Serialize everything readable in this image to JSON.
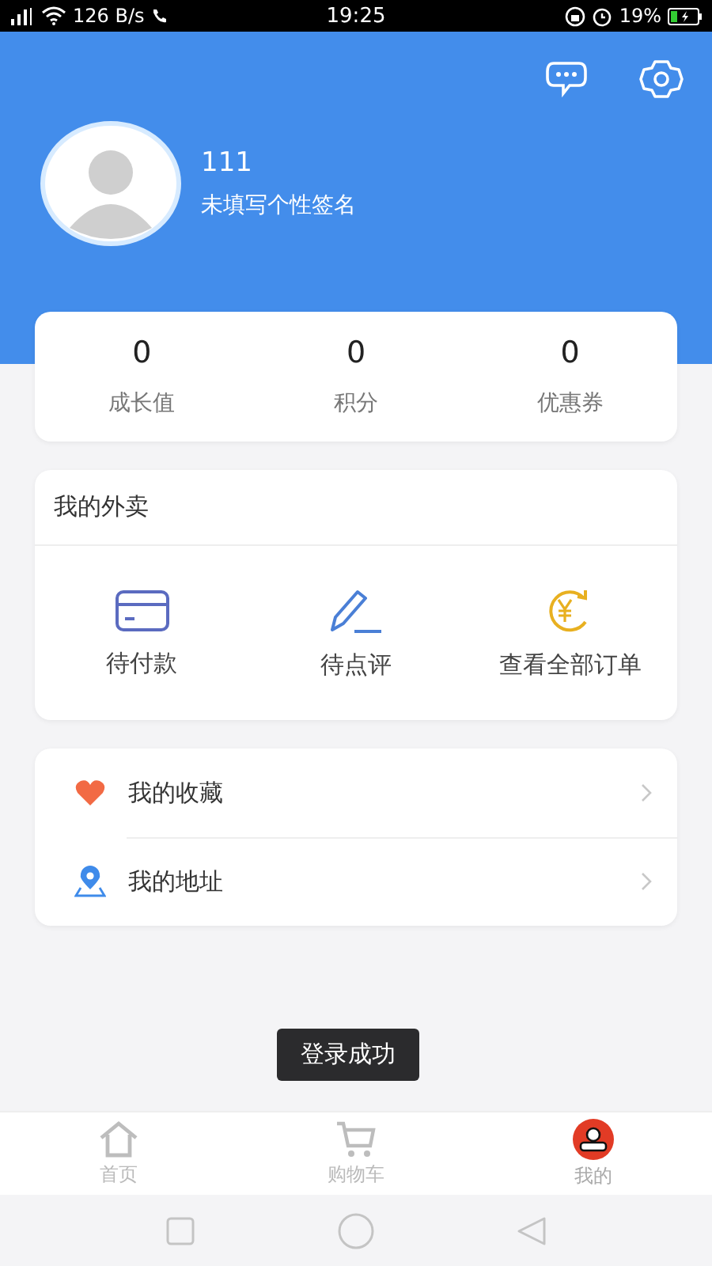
{
  "status_bar": {
    "network": "126 B/s",
    "time": "19:25",
    "battery": "19%"
  },
  "profile": {
    "name": "111",
    "signature": "未填写个性签名"
  },
  "stats": [
    {
      "value": "0",
      "label": "成长值"
    },
    {
      "value": "0",
      "label": "积分"
    },
    {
      "value": "0",
      "label": "优惠券"
    }
  ],
  "orders": {
    "title": "我的外卖",
    "items": [
      {
        "kind": "card",
        "label": "待付款"
      },
      {
        "kind": "pen",
        "label": "待点评"
      },
      {
        "kind": "yen",
        "label": "查看全部订单"
      }
    ]
  },
  "menu": [
    {
      "kind": "heart",
      "label": "我的收藏"
    },
    {
      "kind": "pin",
      "label": "我的地址"
    }
  ],
  "toast": "登录成功",
  "tabs": [
    {
      "kind": "home",
      "label": "首页",
      "selected": false
    },
    {
      "kind": "cart",
      "label": "购物车",
      "selected": false
    },
    {
      "kind": "me",
      "label": "我的",
      "selected": true
    }
  ]
}
